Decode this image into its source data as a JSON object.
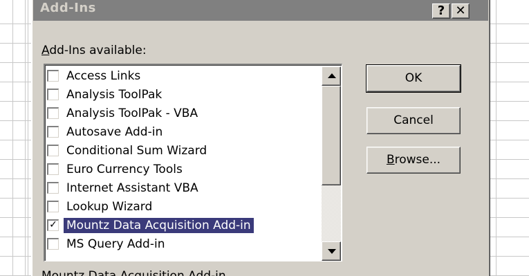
{
  "dialog": {
    "title": "Add-Ins",
    "help_button": "?",
    "close_button": "✕"
  },
  "available_label_accel": "A",
  "available_label_rest": "dd-Ins available:",
  "items": [
    {
      "label": "Access Links",
      "checked": false,
      "selected": false
    },
    {
      "label": "Analysis ToolPak",
      "checked": false,
      "selected": false
    },
    {
      "label": "Analysis ToolPak - VBA",
      "checked": false,
      "selected": false
    },
    {
      "label": "Autosave Add-in",
      "checked": false,
      "selected": false
    },
    {
      "label": "Conditional Sum Wizard",
      "checked": false,
      "selected": false
    },
    {
      "label": "Euro Currency Tools",
      "checked": false,
      "selected": false
    },
    {
      "label": "Internet Assistant VBA",
      "checked": false,
      "selected": false
    },
    {
      "label": "Lookup Wizard",
      "checked": false,
      "selected": false
    },
    {
      "label": "Mountz Data Acquisition Add-in",
      "checked": true,
      "selected": true
    },
    {
      "label": "MS Query Add-in",
      "checked": false,
      "selected": false
    }
  ],
  "buttons": {
    "ok": "OK",
    "cancel": "Cancel",
    "browse_accel": "B",
    "browse_rest": "rowse..."
  },
  "description_fragment": "Mountz Data Acquisition Add-in",
  "colors": {
    "dialog_face": "#d4d0c8",
    "title_inactive": "#808080",
    "selection": "#3a3a7a"
  }
}
